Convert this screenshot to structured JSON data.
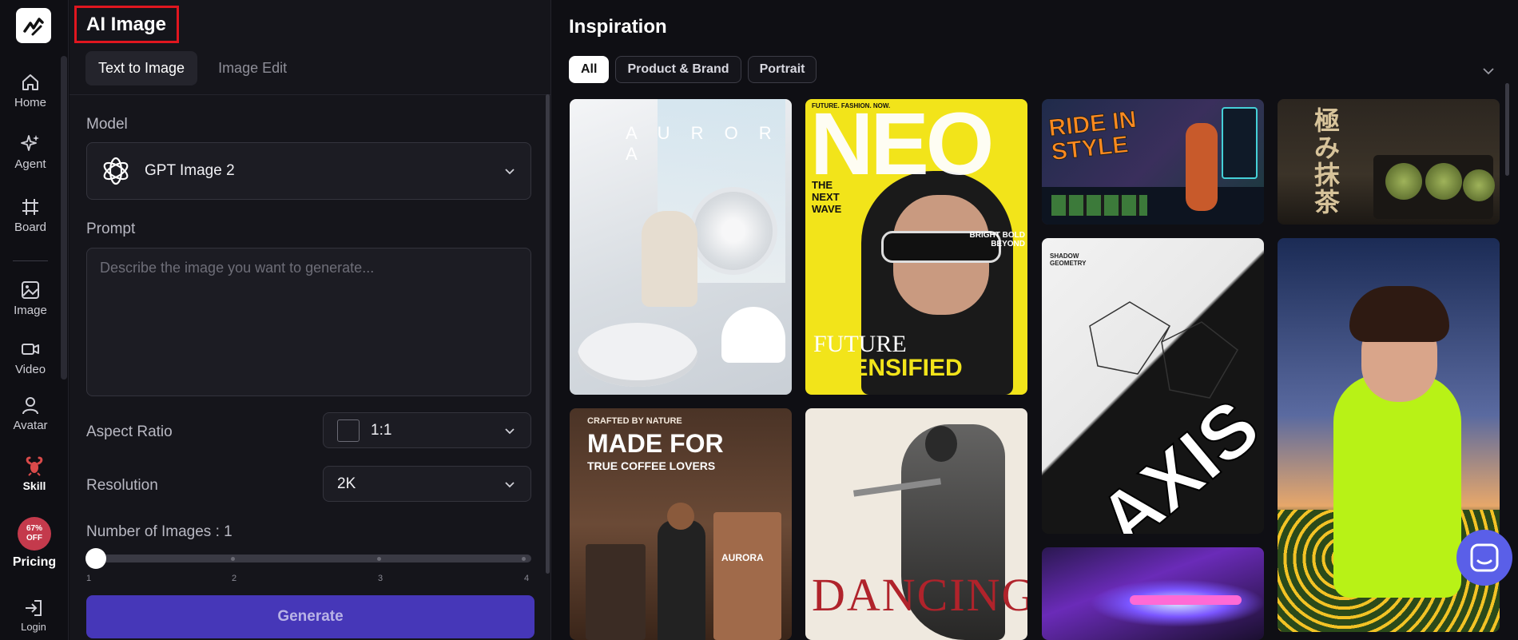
{
  "nav": {
    "items": [
      {
        "label": "Home",
        "icon": "home-icon"
      },
      {
        "label": "Agent",
        "icon": "sparkle-icon"
      },
      {
        "label": "Board",
        "icon": "grid-icon"
      },
      {
        "label": "Image",
        "icon": "image-icon"
      },
      {
        "label": "Video",
        "icon": "video-icon"
      },
      {
        "label": "Avatar",
        "icon": "user-icon"
      },
      {
        "label": "Skill",
        "icon": "lobster-icon"
      }
    ],
    "pricing": {
      "badge_line1": "67%",
      "badge_line2": "OFF",
      "label": "Pricing"
    },
    "login": {
      "label": "Login",
      "icon": "login-icon"
    }
  },
  "panel": {
    "title": "AI Image",
    "tabs": [
      "Text to Image",
      "Image Edit"
    ],
    "model": {
      "label": "Model",
      "value": "GPT Image 2"
    },
    "prompt": {
      "label": "Prompt",
      "placeholder": "Describe the image you want to generate..."
    },
    "aspect_ratio": {
      "label": "Aspect Ratio",
      "value": "1:1"
    },
    "resolution": {
      "label": "Resolution",
      "value": "2K"
    },
    "num_images": {
      "label": "Number of Images : 1",
      "value": 1,
      "min": 1,
      "max": 4,
      "ticks": [
        "1",
        "2",
        "3",
        "4"
      ]
    },
    "generate_label": "Generate"
  },
  "inspiration": {
    "title": "Inspiration",
    "filters": [
      "All",
      "Product & Brand",
      "Portrait"
    ],
    "active_filter": "All",
    "cards": {
      "aurora": "A U R O R A",
      "neo": {
        "brand": "NEO",
        "top": "FUTURE. FASHION. NOW.",
        "line1": "THE NEXT WAVE",
        "bottom1": "FUTURE",
        "bottom2": "INTENSIFIED",
        "side": "BRIGHT BOLD BEYOND"
      },
      "ride": "RIDE IN STYLE",
      "matcha": "極み抹茶",
      "axis": {
        "title": "AXIS",
        "sub": "SHADOW GEOMETRY"
      },
      "coffee": {
        "pre": "CRAFTED BY NATURE",
        "line1": "MADE FOR",
        "line2": "TRUE COFFEE LOVERS",
        "brand": "AURORA"
      },
      "dancing": "DANCING"
    }
  },
  "colors": {
    "accent": "#4637b8",
    "highlight_box": "#e0161f",
    "chat": "#5a5fe8"
  }
}
